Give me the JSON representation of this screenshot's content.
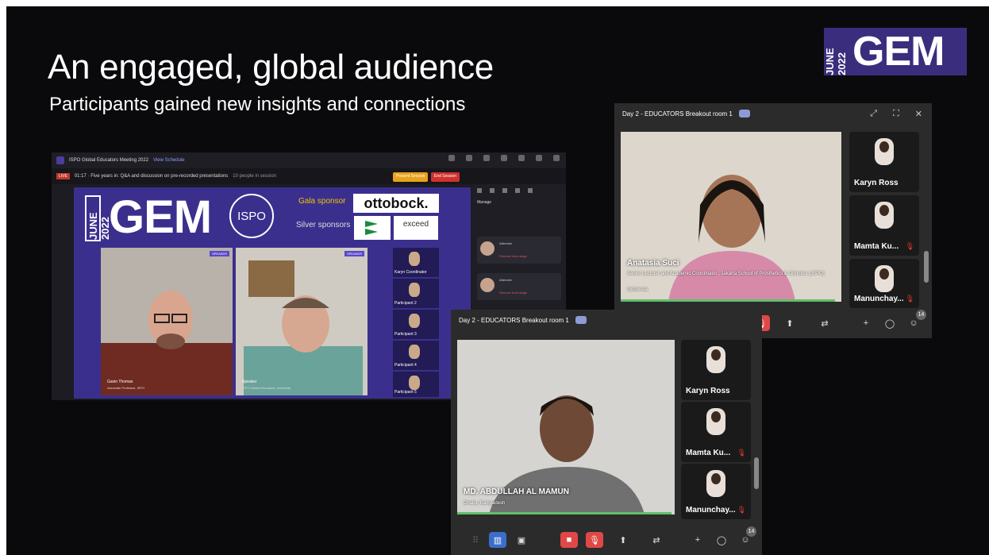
{
  "slide": {
    "title": "An engaged, global audience",
    "subtitle": "Participants gained new insights and connections",
    "logo": {
      "year": "JUNE 2022",
      "word": "GEM"
    },
    "colors": {
      "background": "#0a0a0c",
      "brand_purple": "#3b2d7d"
    }
  },
  "platform": {
    "app_title": "ISPO Global Educators Meeting 2022",
    "app_link": "View Schedule",
    "session_badge": "LIVE",
    "session_title": "01:17 · Five years in: Q&A and discussion on pre-recorded presentations",
    "session_people": "10 people in session",
    "btn_primary": "Present Session",
    "btn_end": "End Session",
    "banner": {
      "gem_year": "JUNE 2022",
      "gem_word": "GEM",
      "ispo": "ISPO",
      "gala_sponsor_label": "Gala sponsor",
      "gala_sponsor": "ottobock.",
      "silver_sponsors_label": "Silver sponsors",
      "silver_sponsor": "exceed"
    },
    "speakers": [
      {
        "name": "Gavin Thomas",
        "affiliation": "Associate Professor, ISPO",
        "tag": "SPEAKER"
      },
      {
        "name": "Speaker",
        "affiliation": "ISPO Global Educators, University",
        "tag": "SPEAKER"
      }
    ],
    "attendees": [
      {
        "name": "Karyn Coordinator"
      },
      {
        "name": "Participant 2"
      },
      {
        "name": "Participant 3"
      },
      {
        "name": "Participant 4"
      },
      {
        "name": "Participant 5"
      }
    ],
    "side_panel": {
      "heading": "Manage",
      "cards": [
        {
          "name": "Attendee",
          "action": "Remove from stage"
        },
        {
          "name": "Attendee",
          "action": "Remove from stage"
        }
      ]
    }
  },
  "meeting1": {
    "title": "Day 2 - EDUCATORS Breakout room 1",
    "main_name": "Anatasia Suci",
    "main_role": "Senior Lecturer and Academic Coordinator , Jakarta School of Prosthetics & Orthotics (JSPO)",
    "main_country": "Indonesia",
    "tiles": [
      {
        "name": "Karyn Ross",
        "muted": false
      },
      {
        "name": "Mamta Ku...",
        "muted": true
      },
      {
        "name": "Manunchay...",
        "muted": true
      }
    ],
    "participants_count": "14"
  },
  "meeting2": {
    "title": "Day 2 - EDUCATORS Breakout room 1",
    "main_name": "MD. ABDULLAH AL MAMUN",
    "main_location": "Dhaka, Bangladesh",
    "tiles": [
      {
        "name": "Karyn Ross",
        "muted": false
      },
      {
        "name": "Mamta Ku...",
        "muted": true
      },
      {
        "name": "Manunchay...",
        "muted": true
      }
    ],
    "participants_count": "14"
  }
}
